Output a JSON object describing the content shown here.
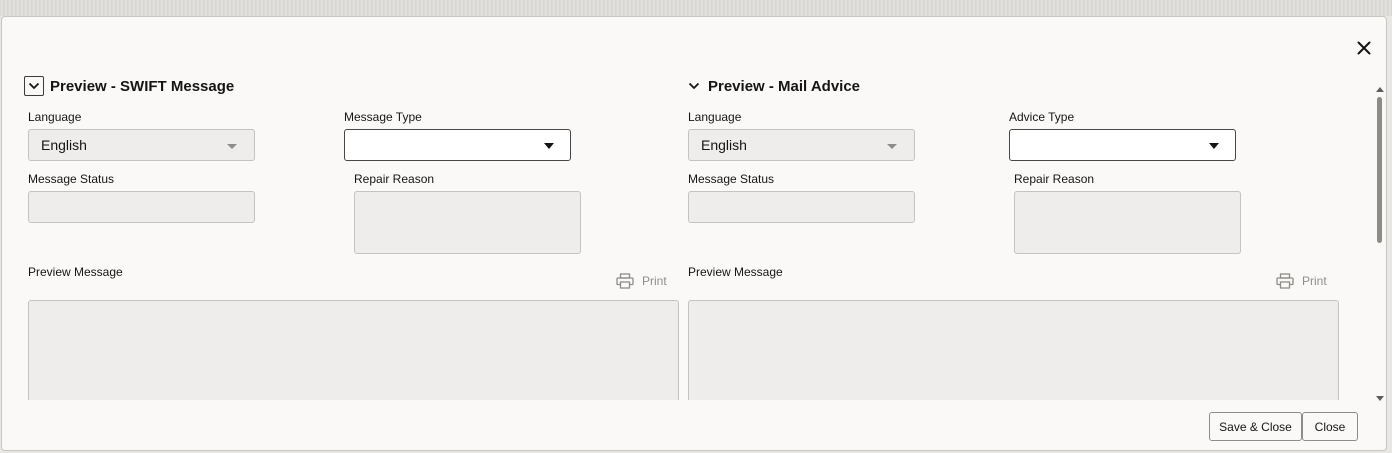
{
  "dialog": {
    "close_icon": "close-icon"
  },
  "swift": {
    "title": "Preview - SWIFT Message",
    "language_label": "Language",
    "language_value": "English",
    "message_type_label": "Message Type",
    "message_type_value": "",
    "message_status_label": "Message Status",
    "message_status_value": "",
    "repair_reason_label": "Repair Reason",
    "repair_reason_value": "",
    "preview_label": "Preview Message",
    "preview_value": "",
    "print_label": "Print",
    "collapse_icon": "chevron-down-icon",
    "print_icon": "printer-icon"
  },
  "mail": {
    "title": "Preview - Mail Advice",
    "language_label": "Language",
    "language_value": "English",
    "advice_type_label": "Advice Type",
    "advice_type_value": "",
    "message_status_label": "Message Status",
    "message_status_value": "",
    "repair_reason_label": "Repair Reason",
    "repair_reason_value": "",
    "preview_label": "Preview Message",
    "preview_value": "",
    "print_label": "Print",
    "collapse_icon": "chevron-down-icon",
    "print_icon": "printer-icon"
  },
  "footer": {
    "save_close_label": "Save & Close",
    "close_label": "Close"
  }
}
